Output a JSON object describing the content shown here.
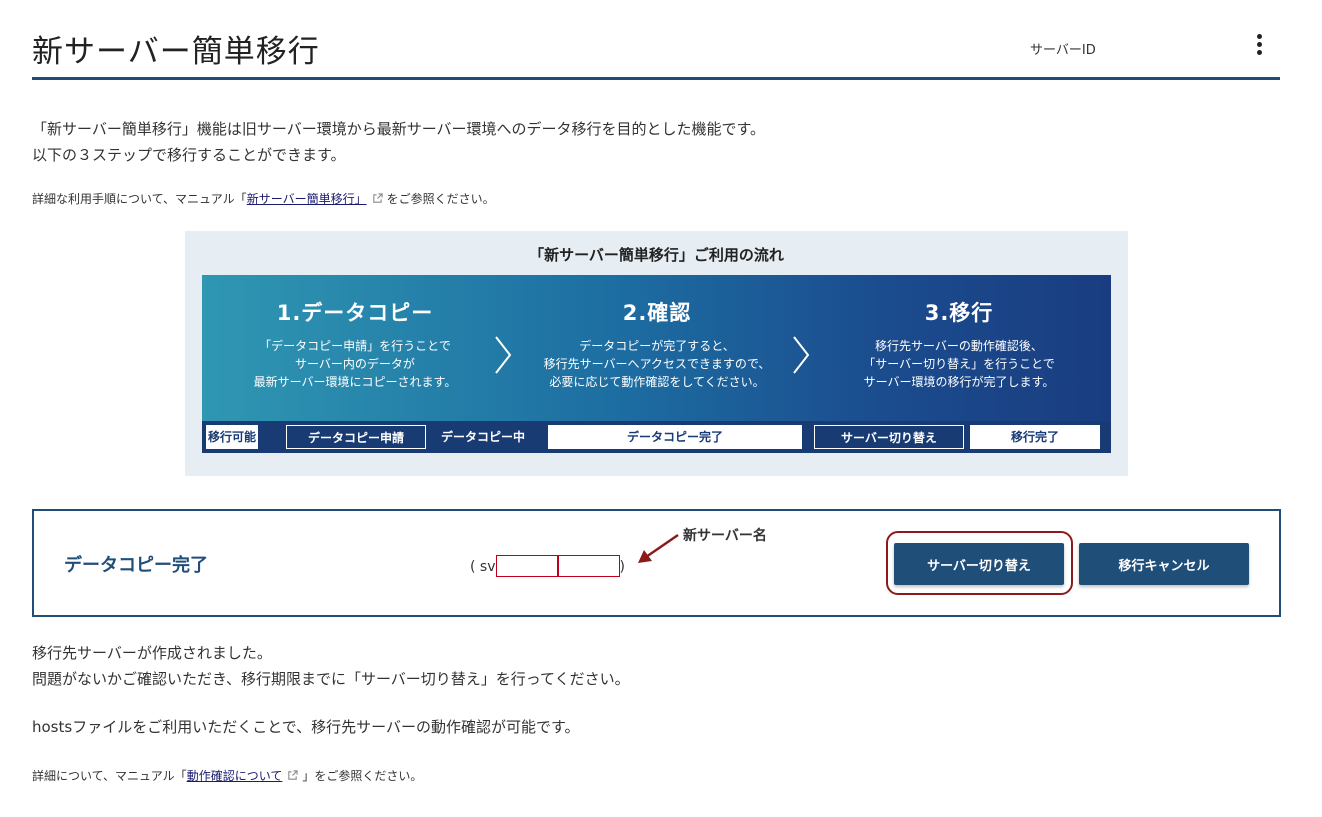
{
  "header": {
    "title": "新サーバー簡単移行",
    "server_id_label": "サーバーID"
  },
  "intro": {
    "line1": "「新サーバー簡単移行」機能は旧サーバー環境から最新サーバー環境へのデータ移行を目的とした機能です。",
    "line2": "以下の３ステップで移行することができます。"
  },
  "manual": {
    "prefix": "詳細な利用手順について、マニュアル「",
    "link": "新サーバー簡単移行」",
    "suffix": "をご参照ください。"
  },
  "flow": {
    "title": "「新サーバー簡単移行」ご利用の流れ",
    "steps": [
      {
        "heading": "1.データコピー",
        "lines": [
          "「データコピー申請」を行うことで",
          "サーバー内のデータが",
          "最新サーバー環境にコピーされます。"
        ]
      },
      {
        "heading": "2.確認",
        "lines": [
          "データコピーが完了すると、",
          "移行先サーバーへアクセスできますので、",
          "必要に応じて動作確認をしてください。"
        ]
      },
      {
        "heading": "3.移行",
        "lines": [
          "移行先サーバーの動作確認後、",
          "「サーバー切り替え」を行うことで",
          "サーバー環境の移行が完了します。"
        ]
      }
    ],
    "status_steps": [
      "移行可能",
      "データコピー申請",
      "データコピー中",
      "データコピー完了",
      "サーバー切り替え",
      "移行完了"
    ]
  },
  "status": {
    "title": "データコピー完了",
    "server_prefix": "( sv",
    "server_suffix": ")",
    "annotation": "新サーバー名",
    "switch_button": "サーバー切り替え",
    "cancel_button": "移行キャンセル"
  },
  "message": {
    "line1": "移行先サーバーが作成されました。",
    "line2": "問題がないかご確認いただき、移行期限までに「サーバー切り替え」を行ってください。",
    "hosts": "hostsファイルをご利用いただくことで、移行先サーバーの動作確認が可能です。"
  },
  "detail": {
    "prefix": "詳細について、マニュアル「",
    "link": "動作確認について",
    "suffix": "」をご参照ください。"
  },
  "icons": [
    "more-vertical-icon",
    "external-link-icon",
    "chevron-right-icon",
    "arrow-pointer-icon"
  ],
  "colors": {
    "primary": "#1f4e79",
    "highlight": "#8b1a1a",
    "redact": "#c0001a",
    "flow_bg": "#e6edf3"
  }
}
